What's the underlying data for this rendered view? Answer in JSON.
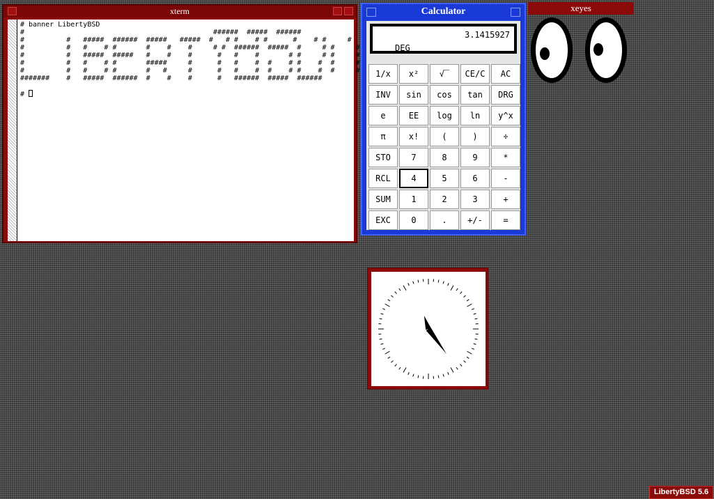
{
  "xterm": {
    "title": "xterm",
    "content": "# banner LibertyBSD\n#                                             ######  #####  ######\n#          #   #####  ######  #####   #####  #   # #    # #      #    # #     #\n#          #   #    # #       #    #    #     # #  ######  #####  #     # #     #\n#          #   #####  #####   #    #    #      #   #    #       # #     # #     #\n#          #   #    # #       #####     #      #   #    #  #    # #    #  #     #\n#          #   #    # #       #   #     #      #   #    #  #    # #    #  #     #\n#######    #   #####  ######  #    #    #      #   ######  #####  ######\n\n# "
  },
  "calculator": {
    "title": "Calculator",
    "display_value": "3.1415927",
    "display_mode": "DEG",
    "active_key": "4",
    "keys": [
      "1/x",
      "x²",
      "√‾",
      "CE/C",
      "AC",
      "INV",
      "sin",
      "cos",
      "tan",
      "DRG",
      "e",
      "EE",
      "log",
      "ln",
      "y^x",
      "π",
      "x!",
      "(",
      ")",
      "÷",
      "STO",
      "7",
      "8",
      "9",
      "*",
      "RCL",
      "4",
      "5",
      "6",
      "-",
      "SUM",
      "1",
      "2",
      "3",
      "+",
      "EXC",
      "0",
      ".",
      "+/-",
      "="
    ]
  },
  "xeyes": {
    "title": "xeyes"
  },
  "clock": {
    "hour": 11,
    "minute": 24
  },
  "taskbar": {
    "label": "LibertyBSD 5.6"
  },
  "colors": {
    "window_frame": "#8b0a0a",
    "calculator_frame": "#1a3ad8",
    "desktop": "#3a3a3a"
  }
}
